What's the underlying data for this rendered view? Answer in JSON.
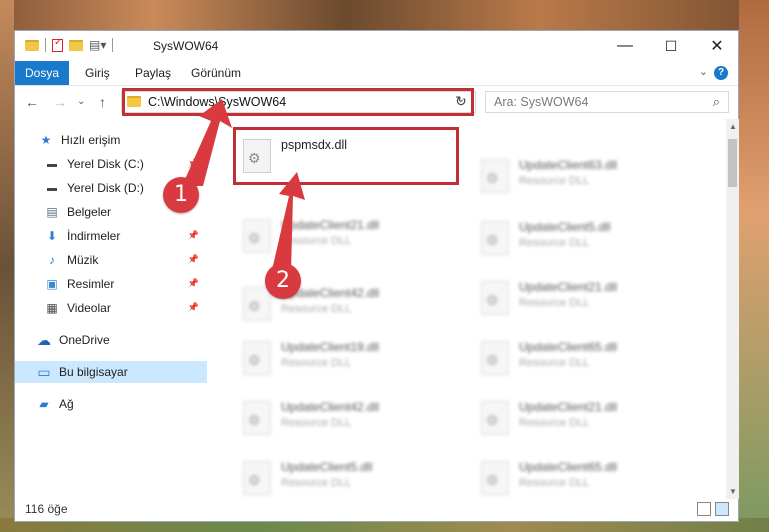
{
  "window": {
    "title": "SysWOW64",
    "minimize": "—",
    "maximize": "☐",
    "close": "✕"
  },
  "ribbon": {
    "tabs": [
      "Dosya",
      "Giriş",
      "Paylaş",
      "Görünüm"
    ],
    "collapse": "⌄",
    "help": "?"
  },
  "nav": {
    "back": "←",
    "forward": "→",
    "recent": "⌄",
    "up": "↑",
    "address": "C:\\Windows\\SysWOW64",
    "address_dropdown": "⌄",
    "refresh": "↻",
    "search_placeholder": "Ara: SysWOW64",
    "search_icon": "⌕"
  },
  "sidebar": {
    "items": [
      {
        "label": "Hızlı erişim",
        "icon": "star-icon",
        "glyph": "★",
        "color": "#2b7cd3"
      },
      {
        "label": "Yerel Disk (C:)",
        "icon": "drive-icon",
        "glyph": "▬",
        "color": "#444"
      },
      {
        "label": "Yerel Disk (D:)",
        "icon": "drive-icon",
        "glyph": "▬",
        "color": "#444"
      },
      {
        "label": "Belgeler",
        "icon": "documents-icon",
        "glyph": "▤",
        "color": "#5a6a7a"
      },
      {
        "label": "İndirmeler",
        "icon": "download-icon",
        "glyph": "⬇",
        "color": "#2b7cd3"
      },
      {
        "label": "Müzik",
        "icon": "music-icon",
        "glyph": "♪",
        "color": "#2b7cd3"
      },
      {
        "label": "Resimler",
        "icon": "pictures-icon",
        "glyph": "▣",
        "color": "#3a8ad8"
      },
      {
        "label": "Videolar",
        "icon": "video-icon",
        "glyph": "▦",
        "color": "#444"
      },
      {
        "label": "OneDrive",
        "icon": "cloud-icon",
        "glyph": "☁",
        "color": "#1e64b4"
      },
      {
        "label": "Bu bilgisayar",
        "icon": "computer-icon",
        "glyph": "▭",
        "color": "#2b7cd3"
      },
      {
        "label": "Ağ",
        "icon": "network-icon",
        "glyph": "▰",
        "color": "#2b7cd3"
      }
    ],
    "pin": "📌"
  },
  "files": {
    "highlighted": {
      "name": "pspmsdx.dll",
      "type": ""
    },
    "left_column": [
      {
        "name": "UpdateClient21.dll",
        "type": "Resource DLL"
      },
      {
        "name": "UpdateClient42.dll",
        "type": "Resource DLL"
      },
      {
        "name": "UpdateClient19.dll",
        "type": "Resource DLL"
      },
      {
        "name": "UpdateClient42.dll",
        "type": "Resource DLL"
      },
      {
        "name": "UpdateClient5.dll",
        "type": "Resource DLL"
      }
    ],
    "right_column": [
      {
        "name": "UpdateClient63.dll",
        "type": "Resource DLL"
      },
      {
        "name": "UpdateClient5.dll",
        "type": "Resource DLL"
      },
      {
        "name": "UpdateClient21.dll",
        "type": "Resource DLL"
      },
      {
        "name": "UpdateClient65.dll",
        "type": "Resource DLL"
      },
      {
        "name": "UpdateClient21.dll",
        "type": "Resource DLL"
      },
      {
        "name": "UpdateClient65.dll",
        "type": "Resource DLL"
      }
    ]
  },
  "status": {
    "count": "116 öğe"
  },
  "annotations": {
    "badge1": "1",
    "badge2": "2"
  },
  "colors": {
    "accent": "#1979ca",
    "highlight": "#c22f35",
    "selected": "#cce8ff"
  }
}
